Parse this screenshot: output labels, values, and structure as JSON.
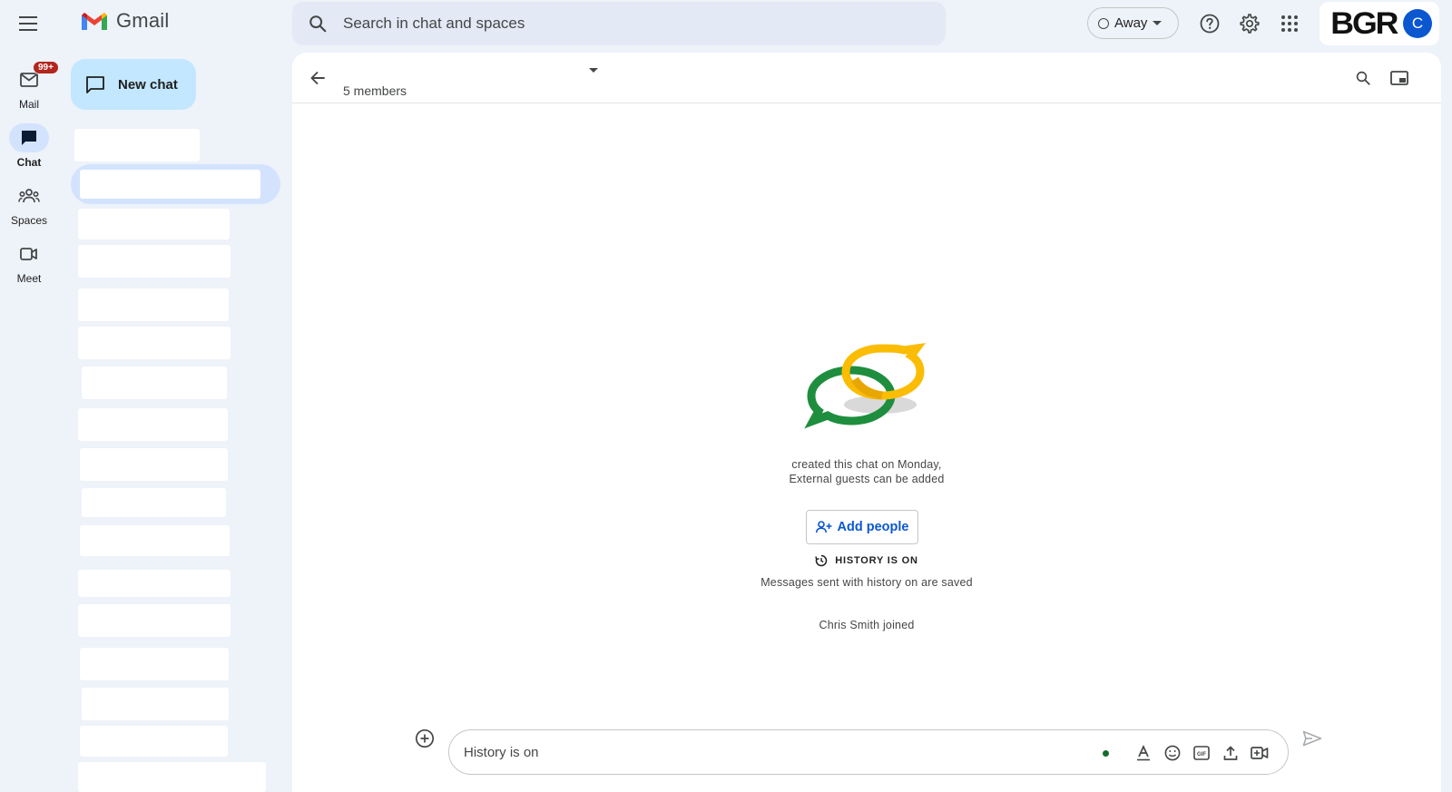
{
  "app": {
    "name": "Gmail"
  },
  "search": {
    "placeholder": "Search in chat and spaces"
  },
  "status": {
    "label": "Away"
  },
  "account": {
    "brand": "BGR",
    "avatar_letter": "C",
    "avatar_color": "#0b57d0"
  },
  "rail": {
    "items": [
      {
        "label": "Mail",
        "icon": "mail-icon",
        "badge": "99+"
      },
      {
        "label": "Chat",
        "icon": "chat-icon",
        "active": true
      },
      {
        "label": "Spaces",
        "icon": "spaces-icon"
      },
      {
        "label": "Meet",
        "icon": "meet-icon"
      }
    ]
  },
  "new_chat": {
    "label": "New chat"
  },
  "chat_header": {
    "members": "5 members"
  },
  "conversation": {
    "created_line": "created this chat on Monday,",
    "guests_line": "External guests can be added",
    "add_people_label": "Add people",
    "history_title": "HISTORY IS ON",
    "history_sub": "Messages sent with history on are saved",
    "joined_line": "Chris Smith joined"
  },
  "composer": {
    "placeholder": "History is on"
  },
  "colors": {
    "accent": "#0b57d0",
    "new_chat_bg": "#c2e7ff",
    "selected_bg": "#d3e3fd",
    "badge": "#b3261e",
    "logo_green": "#1e8e3e",
    "logo_yellow": "#fbbc04"
  }
}
